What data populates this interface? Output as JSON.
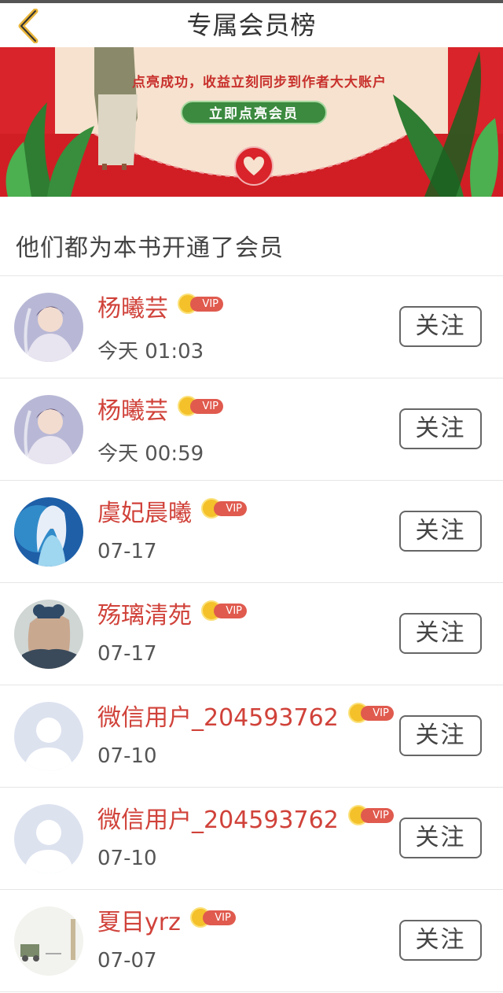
{
  "header": {
    "title": "专属会员榜",
    "back_icon": "chevron-left-icon"
  },
  "banner": {
    "subtitle": "点亮成功，收益立刻同步到作者大大账户",
    "cta_label": "立即点亮会员",
    "colors": {
      "background": "#d8242a",
      "paper": "#f6e2cf",
      "cta": "#3b8a3f"
    }
  },
  "section": {
    "title": "他们都为本书开通了会员"
  },
  "members": [
    {
      "name": "杨曦芸",
      "badge": "VIP",
      "time": "今天 01:03",
      "follow_label": "关注",
      "avatar": "portrait-photo"
    },
    {
      "name": "杨曦芸",
      "badge": "VIP",
      "time": "今天 00:59",
      "follow_label": "关注",
      "avatar": "portrait-photo"
    },
    {
      "name": "虞妃晨曦",
      "badge": "VIP",
      "time": "07-17",
      "follow_label": "关注",
      "avatar": "fantasy-character"
    },
    {
      "name": "殇璃清苑",
      "badge": "VIP",
      "time": "07-17",
      "follow_label": "关注",
      "avatar": "girl-with-bow"
    },
    {
      "name": "微信用户_204593762",
      "badge": "VIP",
      "time": "07-10",
      "follow_label": "关注",
      "avatar": "default-user"
    },
    {
      "name": "微信用户_204593762",
      "badge": "VIP",
      "time": "07-10",
      "follow_label": "关注",
      "avatar": "default-user"
    },
    {
      "name": "夏目yrz",
      "badge": "VIP",
      "time": "07-07",
      "follow_label": "关注",
      "avatar": "sketch-drawing"
    }
  ],
  "colors": {
    "name": "#d0423a",
    "vip_pill": "#e05a4e",
    "vip_crown": "#f4c12a"
  }
}
